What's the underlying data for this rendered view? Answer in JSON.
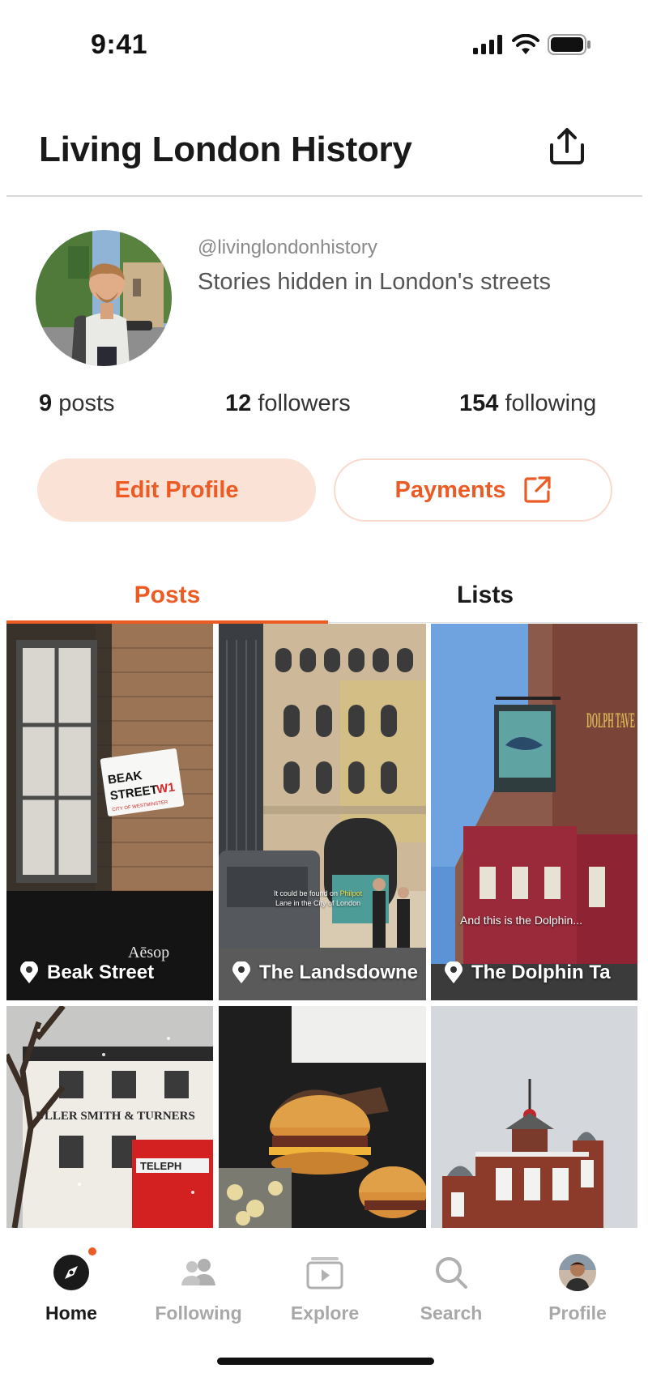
{
  "status_bar": {
    "time": "9:41"
  },
  "header": {
    "title": "Living London History"
  },
  "profile": {
    "handle": "@livinglondonhistory",
    "bio": "Stories hidden in London's streets",
    "stats": {
      "posts_count": "9",
      "posts_label": "posts",
      "followers_count": "12",
      "followers_label": "followers",
      "following_count": "154",
      "following_label": "following"
    },
    "edit_button": "Edit Profile",
    "payments_button": "Payments"
  },
  "tabs": [
    {
      "label": "Posts",
      "active": true
    },
    {
      "label": "Lists",
      "active": false
    }
  ],
  "posts": [
    {
      "label": "Beak Street",
      "sign_line1": "BEAK",
      "sign_line2": "STREET",
      "sign_code": "W1",
      "sign_sub": "CITY OF WESTMINSTER",
      "shop": "Aēsop"
    },
    {
      "label": "The Landsdowne",
      "caption_part1": "It could be found on ",
      "caption_highlight": "Philpot",
      "caption_part2": "Lane in the City of London"
    },
    {
      "label": "The Dolphin Ta",
      "caption": "And this is the Dolphin...",
      "facade_text": "DOLPH TAVE"
    },
    {
      "label": "",
      "facade_text": "ULLER SMITH & TURNERS",
      "booth_text": "TELEPH"
    },
    {
      "label": ""
    },
    {
      "label": ""
    }
  ],
  "bottom_nav": [
    {
      "label": "Home",
      "icon": "compass-icon",
      "active": true
    },
    {
      "label": "Following",
      "icon": "people-icon",
      "active": false
    },
    {
      "label": "Explore",
      "icon": "play-card-icon",
      "active": false
    },
    {
      "label": "Search",
      "icon": "search-icon",
      "active": false
    },
    {
      "label": "Profile",
      "icon": "avatar",
      "active": false
    }
  ],
  "colors": {
    "accent": "#ec5b24",
    "accent_soft": "#fbe2d7",
    "text_dark": "#1a1a1a",
    "text_muted": "#a8a8a8"
  }
}
